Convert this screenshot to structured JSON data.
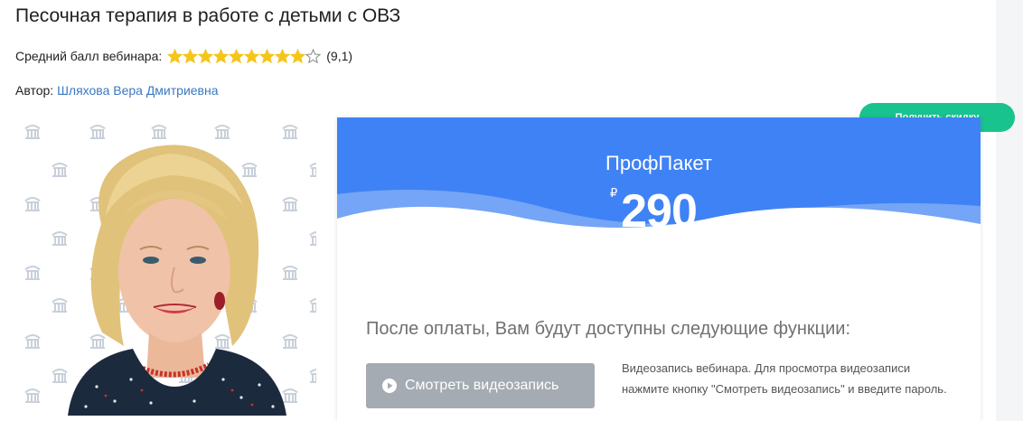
{
  "page": {
    "title": "Песочная терапия в работе с детьми с ОВЗ"
  },
  "rating": {
    "label": "Средний балл вебинара:",
    "value_text": "(9,1)",
    "score": 9.1,
    "max": 10,
    "filled_stars": 9,
    "total_stars": 10,
    "star_color": "#f5c518"
  },
  "author": {
    "label": "Автор:",
    "name": "Шляхова Вера Дмитриевна"
  },
  "discount_button": {
    "label": "Получить скидку",
    "color": "#19c38e"
  },
  "package": {
    "name": "ПрофПакет",
    "currency": "₽",
    "price": "290",
    "header_color": "#3f82f5"
  },
  "features": {
    "heading": "После оплаты, Вам будут доступны следующие функции:",
    "watch_button": "Смотреть видеозапись",
    "watch_description": "Видеозапись вебинара. Для просмотра видеозаписи нажмите кнопку \"Смотреть видеозапись\" и введите пароль."
  },
  "icons": [
    "star-icon",
    "play-icon",
    "logo-pattern-icon"
  ]
}
